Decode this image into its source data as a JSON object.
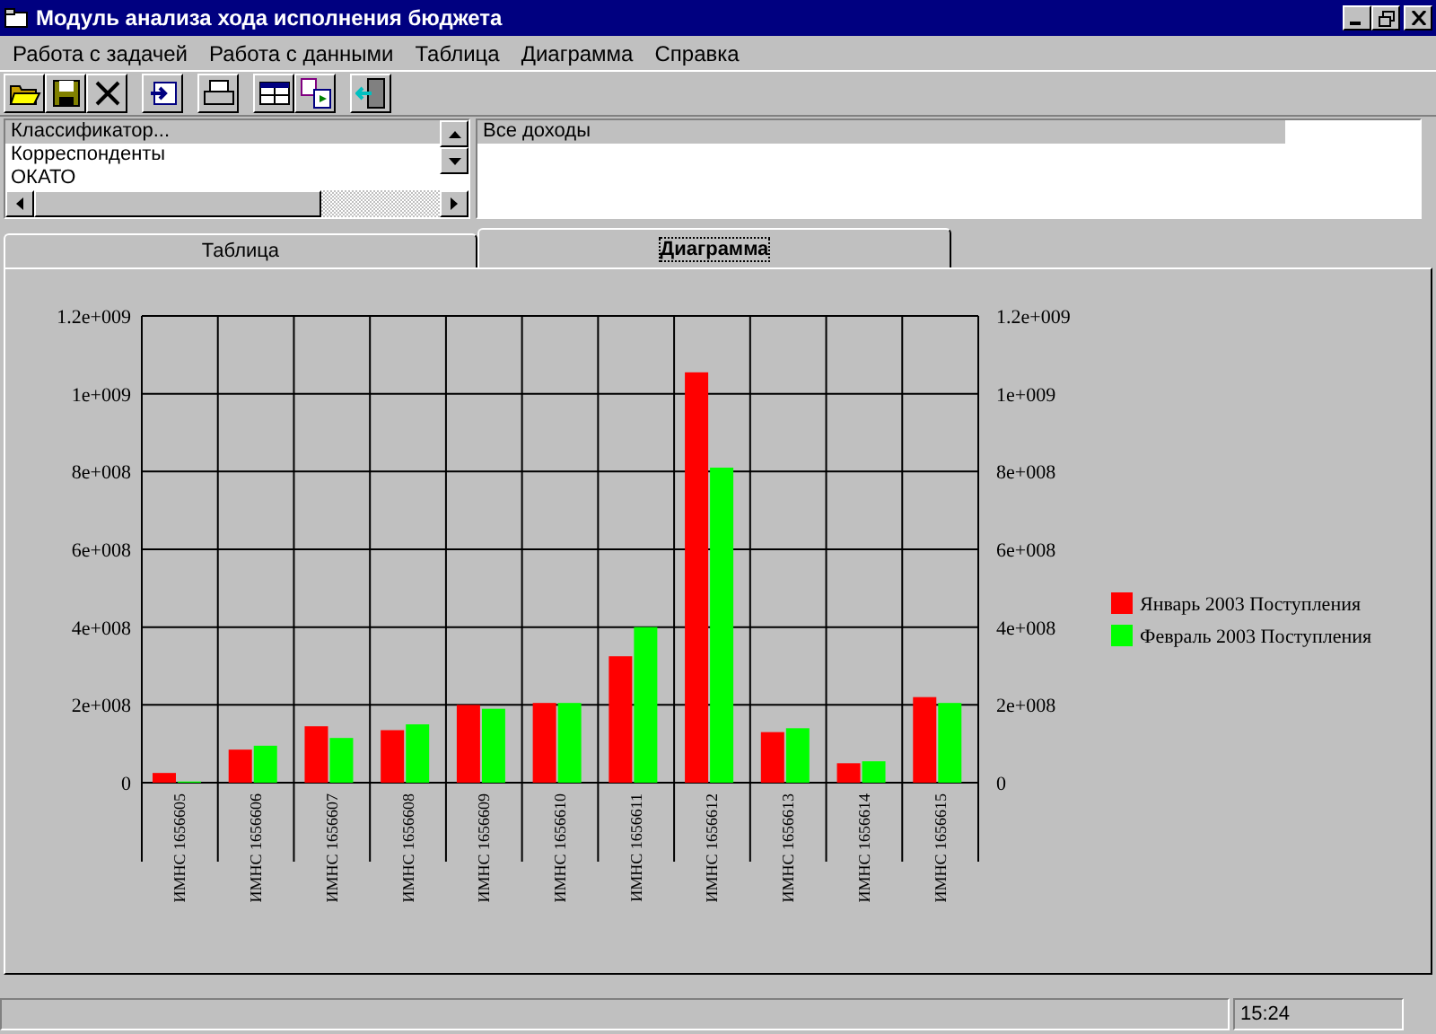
{
  "window": {
    "title": "Модуль анализа хода исполнения бюджета"
  },
  "menu": [
    "Работа с задачей",
    "Работа с данными",
    "Таблица",
    "Диаграмма",
    "Справка"
  ],
  "toolbar": [
    {
      "kind": "open"
    },
    {
      "kind": "save"
    },
    {
      "kind": "delete"
    },
    {
      "kind": "import"
    },
    {
      "kind": "print"
    },
    {
      "kind": "table"
    },
    {
      "kind": "transfer"
    },
    {
      "kind": "exit"
    }
  ],
  "classifier_list": [
    {
      "label": "Классификатор...",
      "selected": true
    },
    {
      "label": "Корреспонденты",
      "selected": false
    },
    {
      "label": "ОКАТО",
      "selected": false
    }
  ],
  "income_list": [
    {
      "label": "Все доходы",
      "selected": true
    }
  ],
  "tabs": [
    {
      "label": "Таблица",
      "selected": false
    },
    {
      "label": "Диаграмма",
      "selected": true
    }
  ],
  "chart_data": {
    "type": "bar",
    "categories": [
      "ИМНС 1656605",
      "ИМНС 1656606",
      "ИМНС 1656607",
      "ИМНС 1656608",
      "ИМНС 1656609",
      "ИМНС 1656610",
      "ИМНС 1656611",
      "ИМНС 1656612",
      "ИМНС 1656613",
      "ИМНС 1656614",
      "ИМНС 1656615"
    ],
    "series": [
      {
        "name": "Январь 2003 Поступления",
        "color": "#ff0000",
        "values": [
          25000000,
          85000000,
          145000000,
          135000000,
          200000000,
          205000000,
          325000000,
          1055000000,
          130000000,
          50000000,
          220000000
        ]
      },
      {
        "name": "Февраль 2003 Поступления",
        "color": "#00ff00",
        "values": [
          3000000,
          95000000,
          115000000,
          150000000,
          190000000,
          205000000,
          400000000,
          810000000,
          140000000,
          55000000,
          205000000
        ]
      }
    ],
    "ylim": [
      0,
      1200000000
    ],
    "grid": true,
    "legend": true,
    "yticks": [
      {
        "value": 0,
        "label": "0"
      },
      {
        "value": 200000000,
        "label": "2e+008"
      },
      {
        "value": 400000000,
        "label": "4e+008"
      },
      {
        "value": 600000000,
        "label": "6e+008"
      },
      {
        "value": 800000000,
        "label": "8e+008"
      },
      {
        "value": 1000000000,
        "label": "1e+009"
      },
      {
        "value": 1200000000,
        "label": "1.2e+009"
      }
    ]
  },
  "status_bar": {
    "time": "15:24"
  }
}
